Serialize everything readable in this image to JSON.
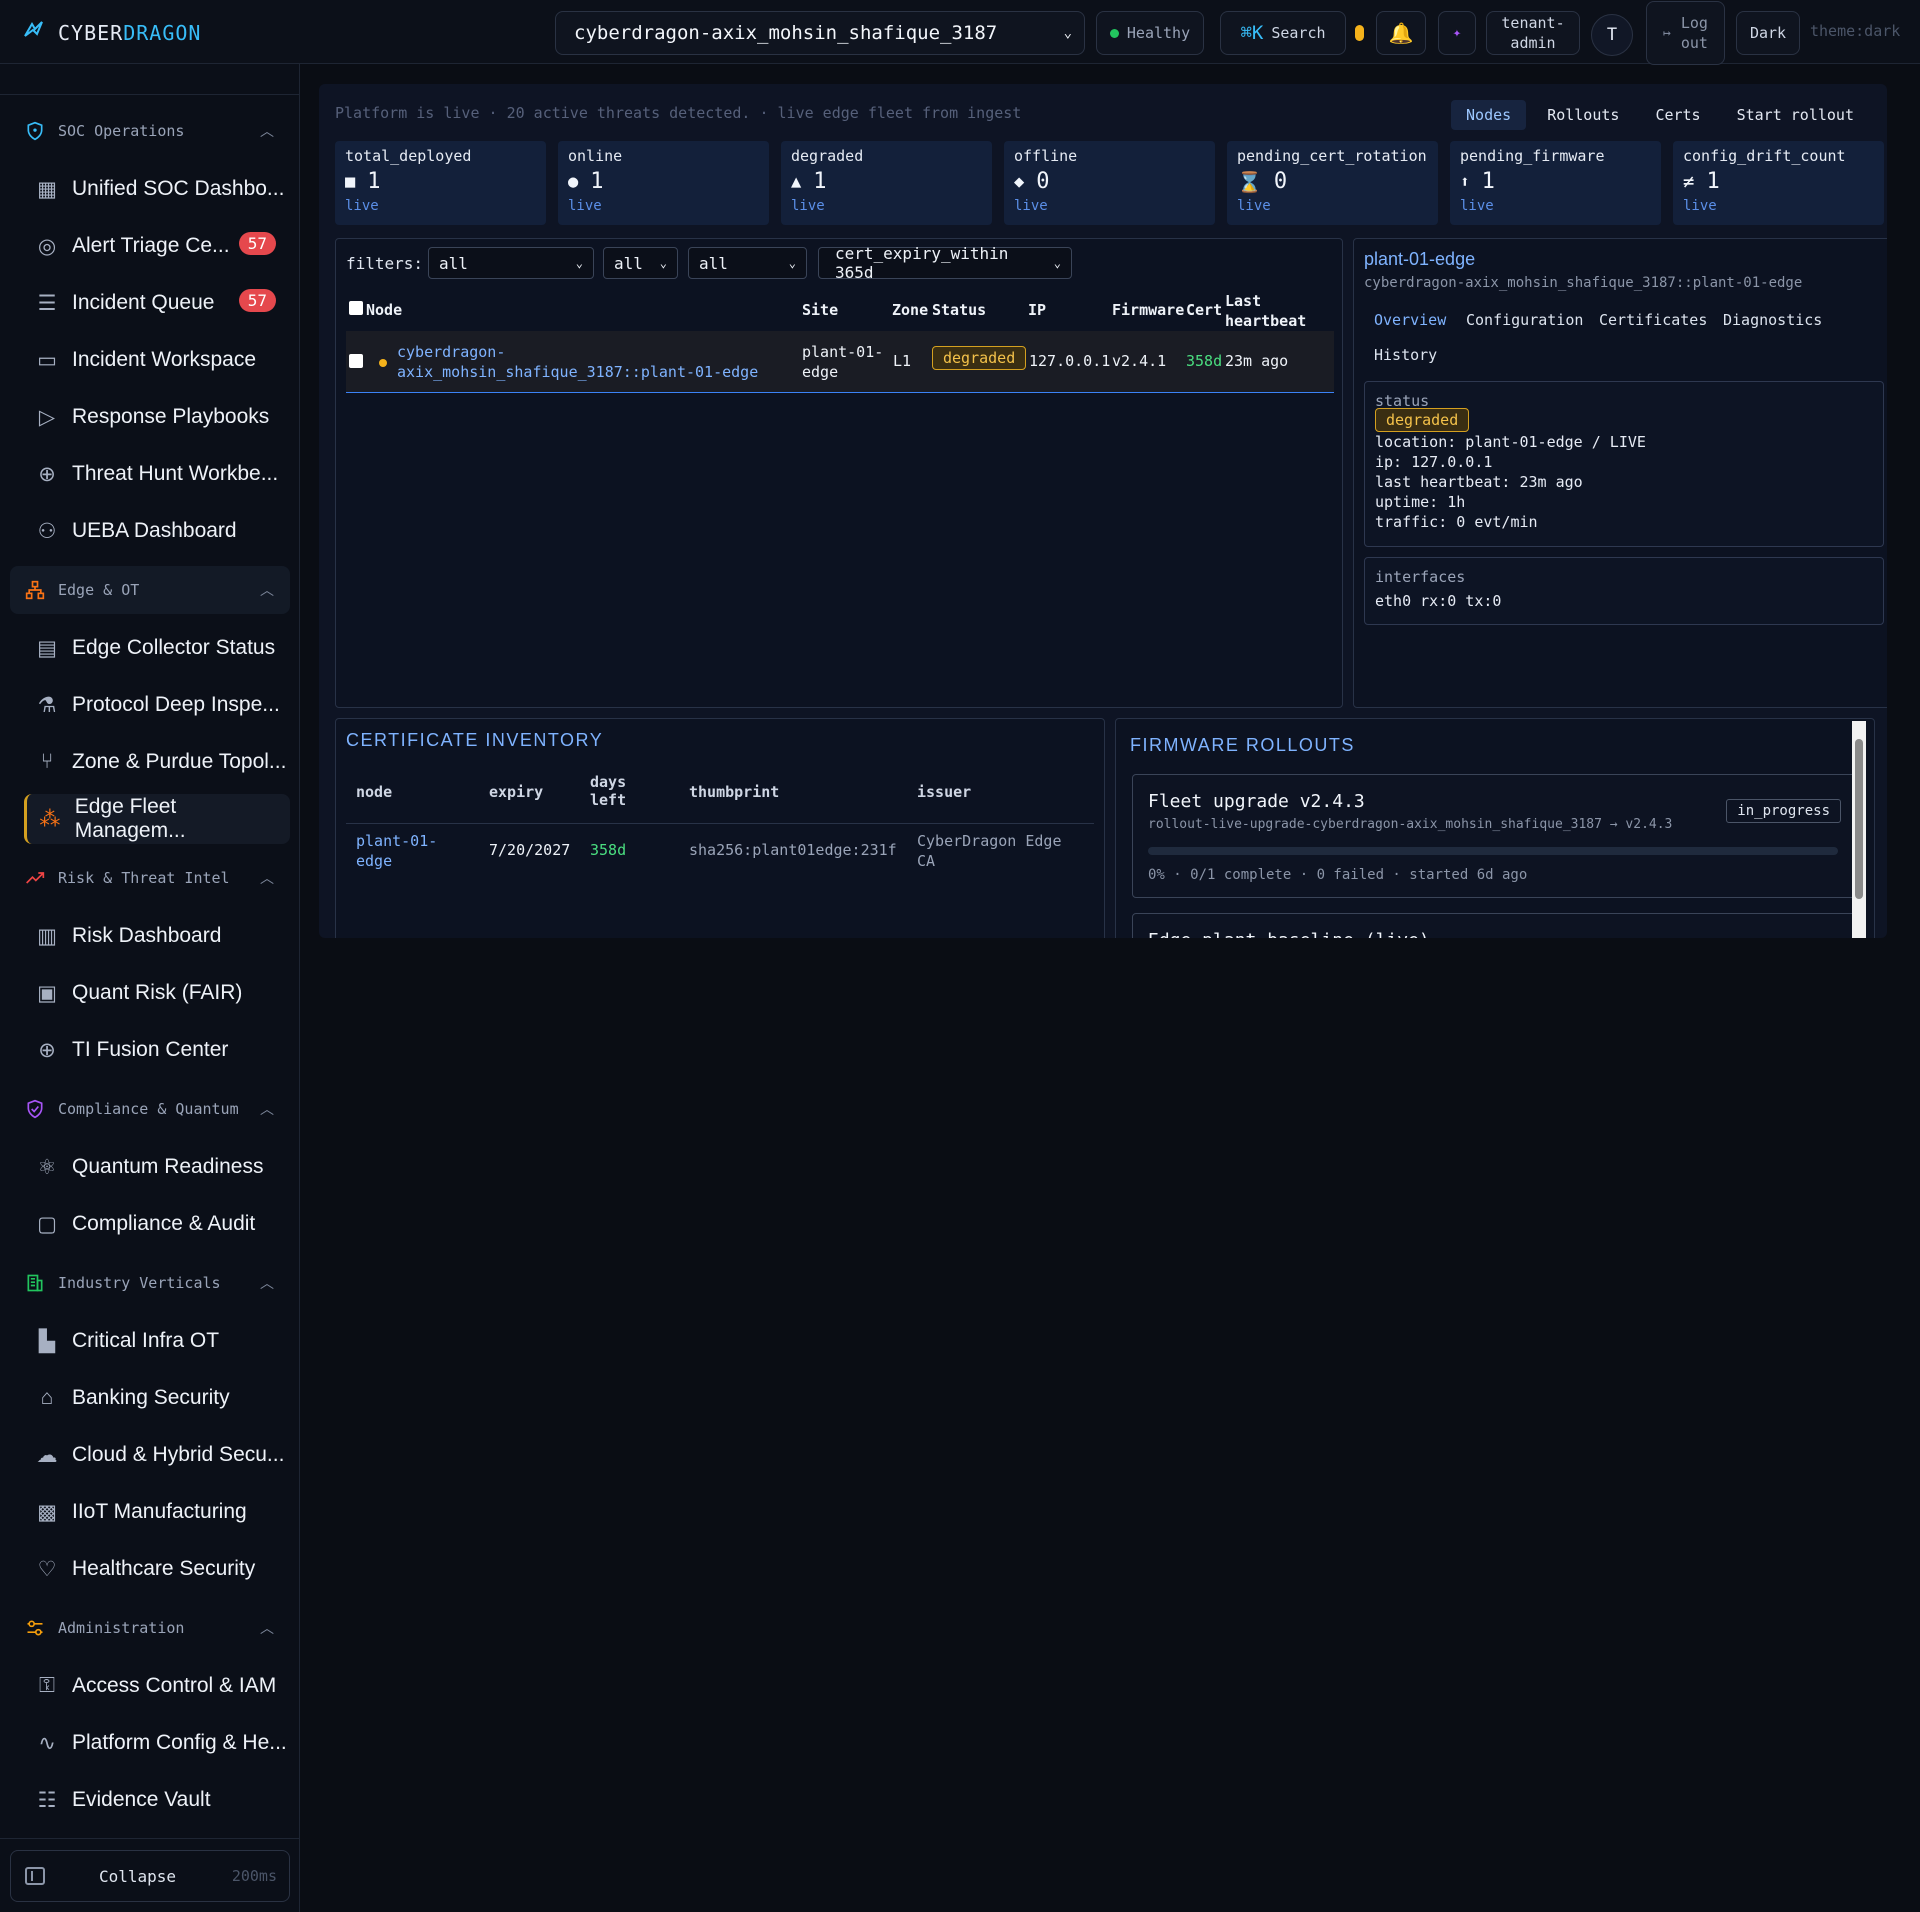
{
  "brand": {
    "part1": "CYBER",
    "part2": "DRAGON"
  },
  "topbar": {
    "tenant": "cyberdragon-axix_mohsin_shafique_3187",
    "health": "Healthy",
    "search_key": "⌘K",
    "search_label": "Search",
    "role_line1": "tenant-",
    "role_line2": "admin",
    "avatar": "T",
    "logout_line1": "Log",
    "logout_line2": "out",
    "theme_button": "Dark",
    "theme_label": "theme:dark"
  },
  "sidebar": {
    "groups": [
      {
        "label": "SOC Operations",
        "items": [
          {
            "label": "Unified SOC Dashbo..."
          },
          {
            "label": "Alert Triage Ce...",
            "badge": "57"
          },
          {
            "label": "Incident Queue",
            "badge": "57"
          },
          {
            "label": "Incident Workspace"
          },
          {
            "label": "Response Playbooks"
          },
          {
            "label": "Threat Hunt Workbe..."
          },
          {
            "label": "UEBA Dashboard"
          }
        ]
      },
      {
        "label": "Edge & OT",
        "items": [
          {
            "label": "Edge Collector Status"
          },
          {
            "label": "Protocol Deep Inspe..."
          },
          {
            "label": "Zone & Purdue Topol..."
          },
          {
            "label": "Edge Fleet Managem..."
          }
        ]
      },
      {
        "label": "Risk & Threat Intel",
        "items": [
          {
            "label": "Risk Dashboard"
          },
          {
            "label": "Quant Risk (FAIR)"
          },
          {
            "label": "TI Fusion Center"
          }
        ]
      },
      {
        "label": "Compliance & Quantum",
        "items": [
          {
            "label": "Quantum Readiness"
          },
          {
            "label": "Compliance & Audit"
          }
        ]
      },
      {
        "label": "Industry Verticals",
        "items": [
          {
            "label": "Critical Infra OT"
          },
          {
            "label": "Banking Security"
          },
          {
            "label": "Cloud & Hybrid Secu..."
          },
          {
            "label": "IIoT Manufacturing"
          },
          {
            "label": "Healthcare Security"
          }
        ]
      },
      {
        "label": "Administration",
        "items": [
          {
            "label": "Access Control & IAM"
          },
          {
            "label": "Platform Config & He..."
          },
          {
            "label": "Evidence Vault"
          }
        ]
      }
    ],
    "collapse_label": "Collapse",
    "collapse_hint": "200ms"
  },
  "main": {
    "banner": "Platform is live · 20 active threats detected. · live edge fleet from ingest",
    "tabs": [
      "Nodes",
      "Rollouts",
      "Certs",
      "Start rollout"
    ],
    "kpis": [
      {
        "label": "total_deployed",
        "glyph": "■",
        "value": "1",
        "sub": "live"
      },
      {
        "label": "online",
        "glyph": "●",
        "value": "1",
        "sub": "live"
      },
      {
        "label": "degraded",
        "glyph": "▲",
        "value": "1",
        "sub": "live"
      },
      {
        "label": "offline",
        "glyph": "◆",
        "value": "0",
        "sub": "live"
      },
      {
        "label": "pending_cert_rotation",
        "glyph": "⌛",
        "value": "0",
        "sub": "live"
      },
      {
        "label": "pending_firmware",
        "glyph": "⬆",
        "value": "1",
        "sub": "live"
      },
      {
        "label": "config_drift_count",
        "glyph": "≠",
        "value": "1",
        "sub": "live"
      }
    ],
    "filters": {
      "label": "filters:",
      "f1": "all",
      "f2": "all",
      "f3": "all",
      "f4": "cert_expiry_within 365d"
    },
    "table": {
      "headers": {
        "node": "Node",
        "site": "Site",
        "zone": "Zone",
        "status": "Status",
        "ip": "IP",
        "firmware": "Firmware",
        "cert": "Cert",
        "hb1": "Last",
        "hb2": "heartbeat"
      },
      "row": {
        "node1": "cyberdragon-",
        "node2": "axix_mohsin_shafique_3187::plant-01-edge",
        "site1": "plant-01-",
        "site2": "edge",
        "zone": "L1",
        "status": "degraded",
        "ip": "127.0.0.1",
        "firmware": "v2.4.1",
        "cert": "358d",
        "heartbeat": "23m ago"
      }
    },
    "detail": {
      "title": "plant-01-edge",
      "subtitle": "cyberdragon-axix_mohsin_shafique_3187::plant-01-edge",
      "tabs": [
        "Overview",
        "Configuration",
        "Certificates",
        "Diagnostics",
        "History"
      ],
      "status_label": "status",
      "status": "degraded",
      "lines": [
        "location: plant-01-edge / LIVE",
        "ip: 127.0.0.1",
        "last heartbeat: 23m ago",
        "uptime: 1h",
        "traffic: 0 evt/min"
      ],
      "interfaces_label": "interfaces",
      "interfaces": "eth0 rx:0 tx:0"
    },
    "cert_inventory": {
      "title": "CERTIFICATE INVENTORY",
      "headers": {
        "node": "node",
        "expiry": "expiry",
        "days1": "days",
        "days2": "left",
        "thumb": "thumbprint",
        "issuer": "issuer"
      },
      "row": {
        "node1": "plant-01-",
        "node2": "edge",
        "expiry": "7/20/2027",
        "days": "358d",
        "thumb": "sha256:plant01edge:231f",
        "issuer1": "CyberDragon Edge",
        "issuer2": "CA"
      }
    },
    "firmware": {
      "title": "FIRMWARE ROLLOUTS",
      "card1": {
        "title": "Fleet upgrade v2.4.3",
        "sub": "rollout-live-upgrade-cyberdragon-axix_mohsin_shafique_3187 → v2.4.3",
        "badge": "in_progress",
        "progress": 0,
        "meta": "0% · 0/1 complete · 0 failed · started 6d ago"
      },
      "card2": {
        "title": "Edge plant baseline (live)"
      }
    }
  },
  "colors": {
    "accent": "#38bdf8",
    "degraded": "#f4c24a",
    "danger": "#e5484d",
    "healthy": "#22c55e",
    "link": "#7fb3ff"
  }
}
